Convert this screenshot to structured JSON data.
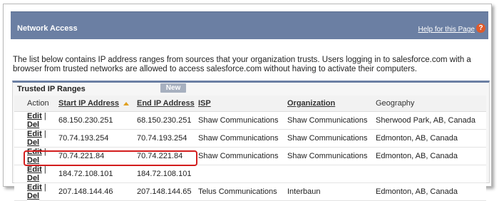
{
  "header": {
    "title": "Network Access",
    "help_link": "Help for this Page",
    "help_icon": "?"
  },
  "description": "The list below contains IP address ranges from sources that your organization trusts. Users logging in to salesforce.com with a browser from trusted networks are allowed to access salesforce.com without having to activate their computers.",
  "panel": {
    "title": "Trusted IP Ranges",
    "new_button": "New"
  },
  "table": {
    "headers": {
      "action": "Action",
      "start": "Start IP Address",
      "end": "End IP Address",
      "isp": "ISP",
      "organization": "Organization",
      "geography": "Geography"
    },
    "edit_label": "Edit",
    "separator": "|",
    "del_label": "Del",
    "rows": [
      {
        "start": "68.150.230.251",
        "end": "68.150.230.251",
        "isp": "Shaw Communications",
        "organization": "Shaw Communications",
        "geography": "Sherwood Park, AB, Canada"
      },
      {
        "start": "70.74.193.254",
        "end": "70.74.193.254",
        "isp": "Shaw Communications",
        "organization": "Shaw Communications",
        "geography": "Edmonton, AB, Canada"
      },
      {
        "start": "70.74.221.84",
        "end": "70.74.221.84",
        "isp": "Shaw Communications",
        "organization": "Shaw Communications",
        "geography": "Edmonton, AB, Canada"
      },
      {
        "start": "184.72.108.101",
        "end": "184.72.108.101",
        "isp": "",
        "organization": "",
        "geography": ""
      },
      {
        "start": "207.148.144.46",
        "end": "207.148.144.65",
        "isp": "Telus Communications",
        "organization": "Interbaun",
        "geography": "Edmonton, AB, Canada"
      }
    ]
  },
  "colors": {
    "header_bg": "#6b7fa3",
    "highlight": "#d31d1d",
    "sort_indicator": "#e0a020"
  }
}
